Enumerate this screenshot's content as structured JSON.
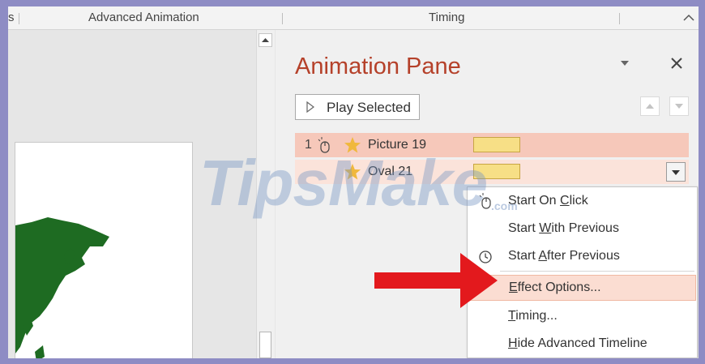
{
  "ribbon": {
    "groups": [
      "Advanced Animation",
      "Timing"
    ],
    "left_fragment": "s"
  },
  "pane": {
    "title": "Animation Pane",
    "play_button": "Play Selected",
    "rows": [
      {
        "number": "1",
        "name": "Picture 19"
      },
      {
        "number": "",
        "name": "Oval 21"
      }
    ]
  },
  "context_menu": {
    "items": [
      {
        "label_pre": "Start On ",
        "accel": "C",
        "label_post": "lick",
        "icon": "mouse-click-icon"
      },
      {
        "label_pre": "Start ",
        "accel": "W",
        "label_post": "ith Previous",
        "icon": ""
      },
      {
        "label_pre": "Start ",
        "accel": "A",
        "label_post": "fter Previous",
        "icon": "clock-icon"
      },
      {
        "label_pre": "",
        "accel": "E",
        "label_post": "ffect Options...",
        "icon": ""
      },
      {
        "label_pre": "",
        "accel": "T",
        "label_post": "iming...",
        "icon": ""
      },
      {
        "label_pre": "",
        "accel": "H",
        "label_post": "ide Advanced Timeline",
        "icon": ""
      }
    ]
  },
  "watermark": {
    "text": "TipsMake",
    "suffix": ".com"
  },
  "colors": {
    "title": "#b5412a",
    "row_selected": "#f6c8ba",
    "row_hover": "#fbe3da",
    "timing_bar": "#f7df86",
    "star": "#f0b83c",
    "arrow": "#e3191d",
    "map": "#1e6b22"
  }
}
